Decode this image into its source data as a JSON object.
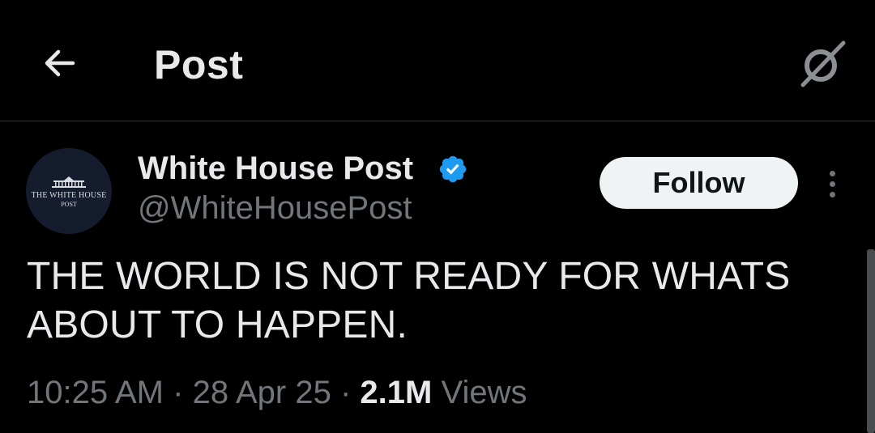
{
  "header": {
    "title": "Post",
    "back_icon": "arrow-left-icon",
    "grok_icon": "grok-icon"
  },
  "author": {
    "display_name": "White House Post",
    "handle": "@WhiteHousePost",
    "verified": true,
    "verified_color": "#1d9bf0",
    "avatar_logo": {
      "name": "THE WHITE HOUSE",
      "sub": "POST"
    }
  },
  "actions": {
    "follow_label": "Follow",
    "more_icon": "more-vertical-icon"
  },
  "tweet": {
    "text": "THE WORLD IS NOT READY FOR WHATS ABOUT TO HAPPEN.",
    "time": "10:25 AM",
    "date": "28 Apr 25",
    "separator": "·",
    "views_count": "2.1M",
    "views_label": "Views"
  },
  "colors": {
    "background": "#000000",
    "text_primary": "#e7e9ea",
    "text_secondary": "#71767b",
    "divider": "#2f3336",
    "follow_bg": "#eff3f4"
  }
}
